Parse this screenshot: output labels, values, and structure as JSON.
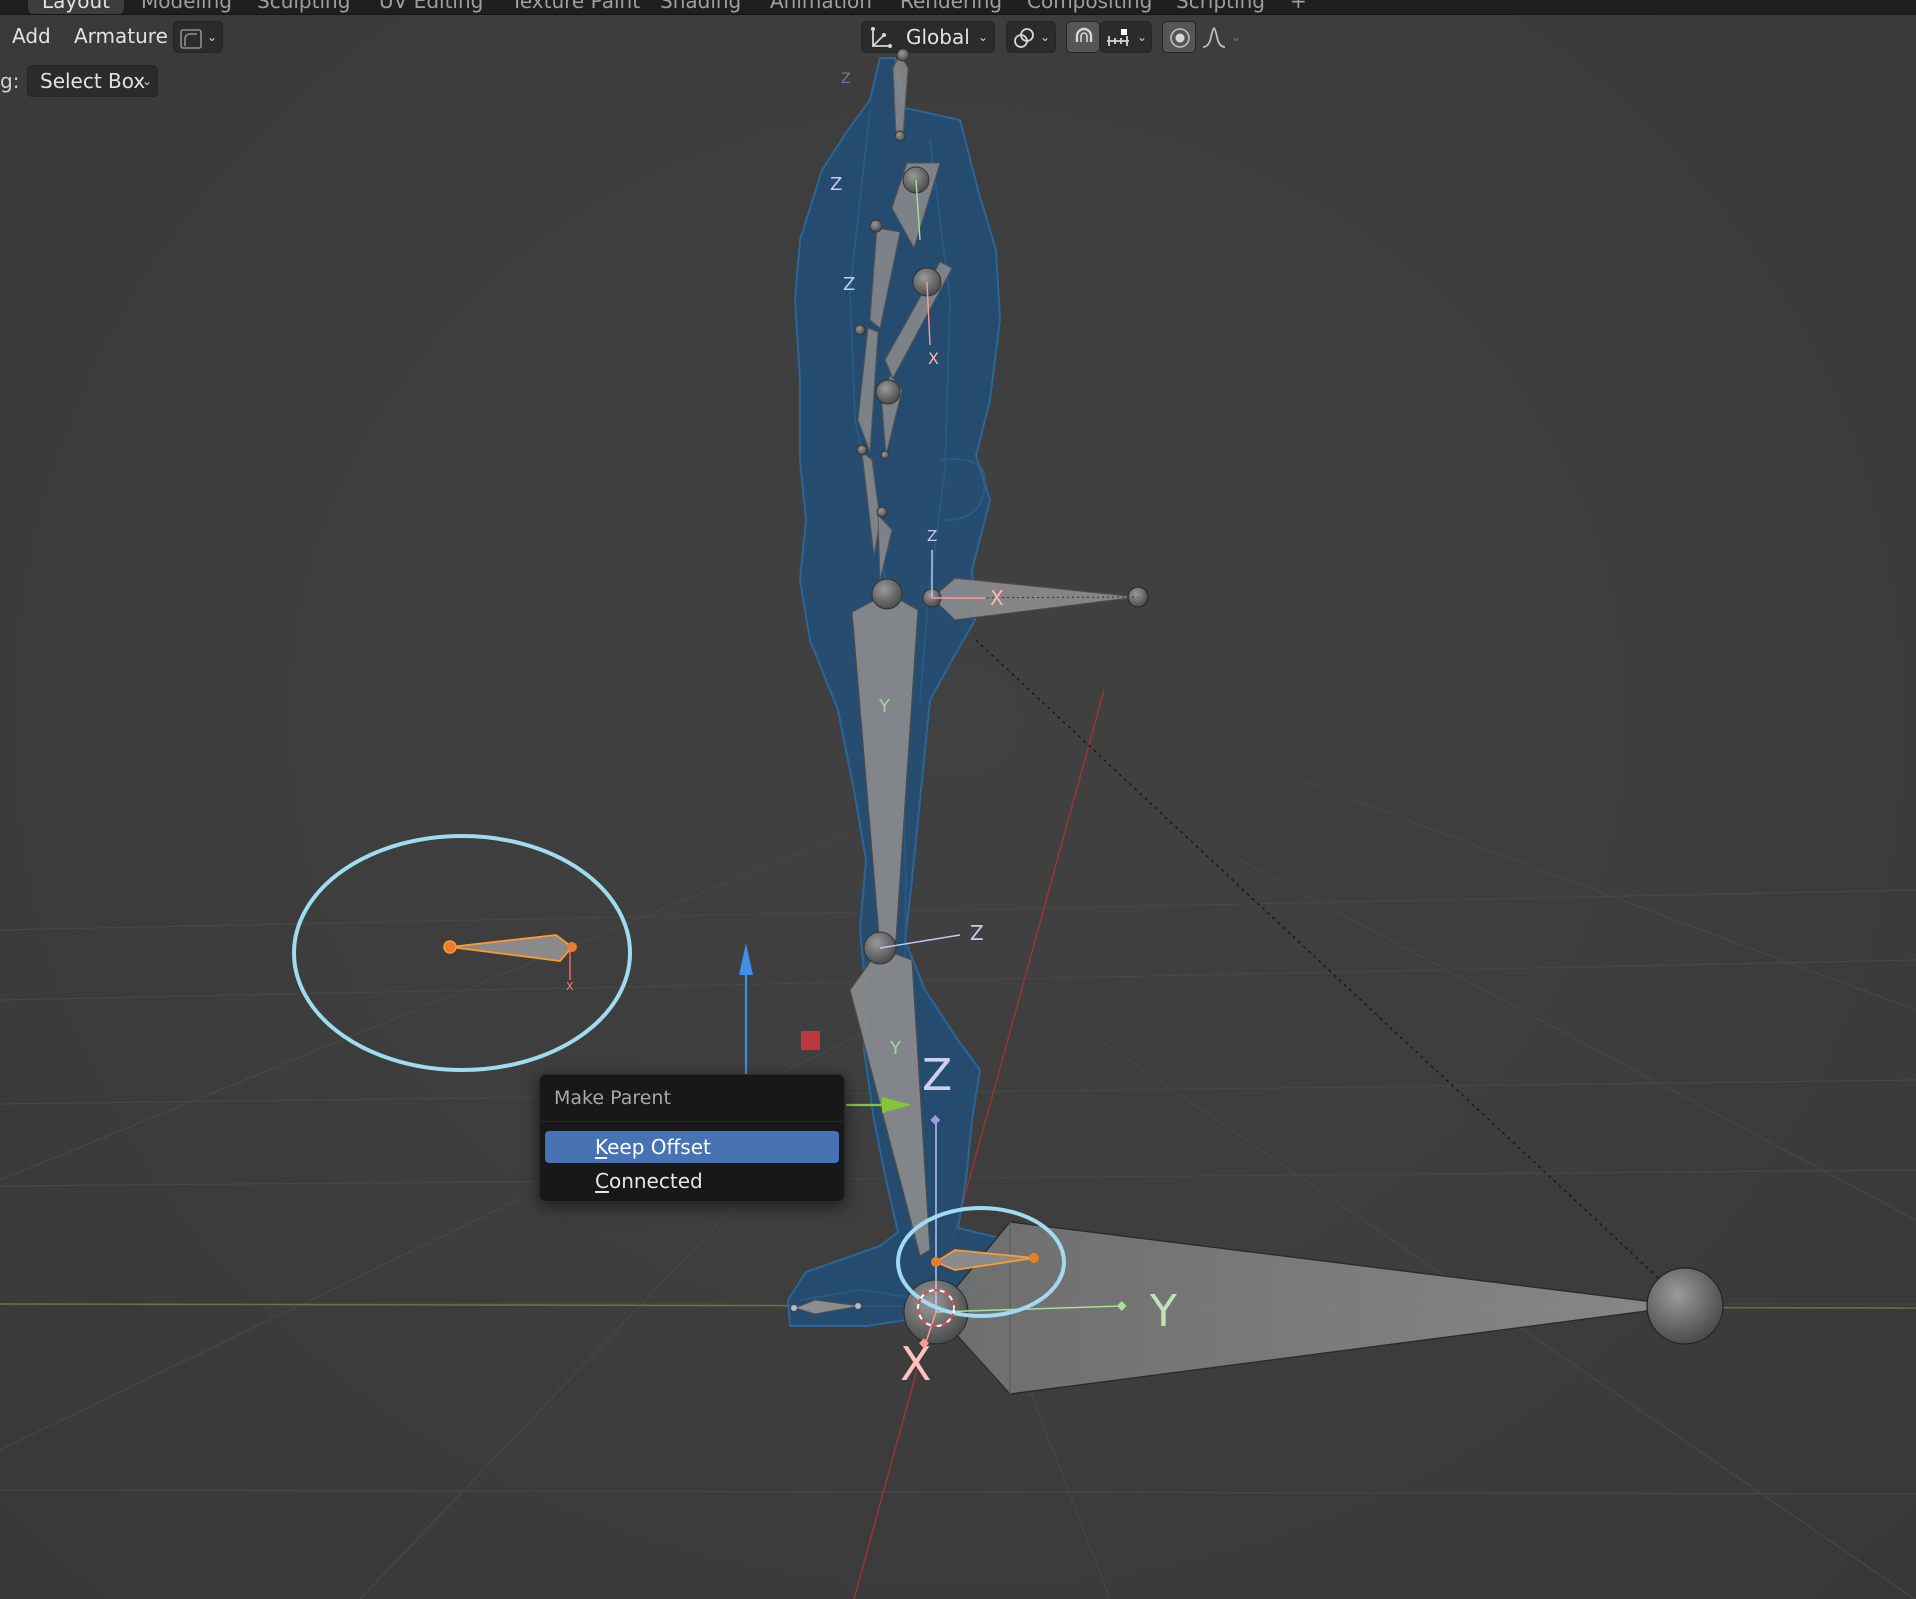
{
  "workspace_tabs": [
    {
      "label": "Layout",
      "active": true
    },
    {
      "label": "Modeling",
      "active": false
    },
    {
      "label": "Sculpting",
      "active": false
    },
    {
      "label": "UV Editing",
      "active": false
    },
    {
      "label": "Texture Paint",
      "active": false
    },
    {
      "label": "Shading",
      "active": false
    },
    {
      "label": "Animation",
      "active": false
    },
    {
      "label": "Rendering",
      "active": false
    },
    {
      "label": "Compositing",
      "active": false
    },
    {
      "label": "Scripting",
      "active": false
    },
    {
      "label": "+",
      "active": false
    }
  ],
  "header": {
    "add_menu": "Add",
    "armature_menu": "Armature",
    "mode_icon": "bone-edit-mode-icon",
    "transform_orientation": "Global",
    "orientation_icon": "transform-axes-icon",
    "pivot_icon": "pivot-point-icon",
    "snap_icon": "magnet-icon",
    "snap_target_icon": "snap-increment-icon",
    "proportional_icon": "proportional-edit-icon",
    "falloff_icon": "falloff-curve-icon"
  },
  "tool_settings": {
    "drag_label": "g:",
    "select_mode": "Select Box"
  },
  "viewport": {
    "axis_labels": {
      "x": "X",
      "y": "Y",
      "z": "Z"
    },
    "colors": {
      "background": "#3d3d3d",
      "mesh": "#1f4f7c",
      "bone": "#8a8a8a",
      "selected_bone": "#ff9a2e",
      "highlight_ring": "#9fdcf0",
      "gizmo_x": "#d8424a",
      "gizmo_y": "#86c53a",
      "gizmo_z": "#3f8fe8"
    }
  },
  "context_menu": {
    "title": "Make Parent",
    "items": [
      {
        "first": "K",
        "rest": "eep Offset",
        "highlighted": true
      },
      {
        "first": "C",
        "rest": "onnected",
        "highlighted": false
      }
    ]
  }
}
